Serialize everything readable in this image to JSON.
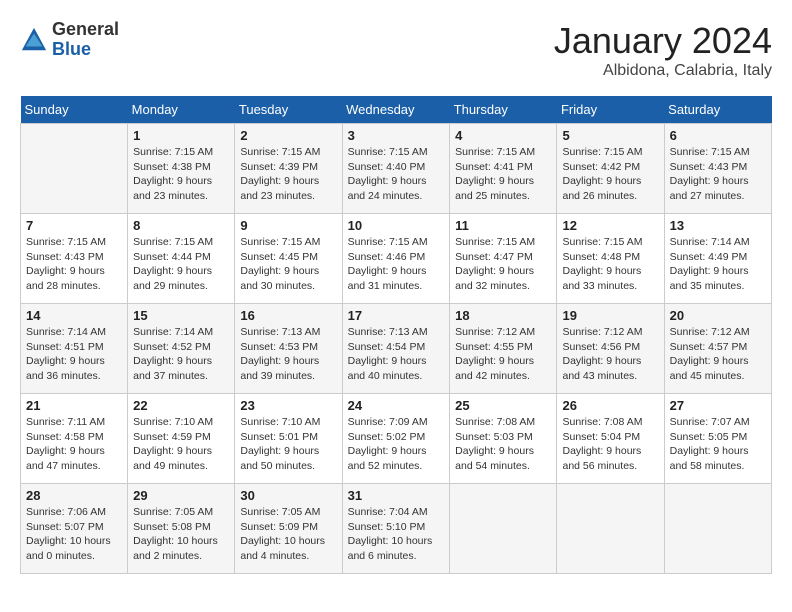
{
  "logo": {
    "general": "General",
    "blue": "Blue"
  },
  "header": {
    "month": "January 2024",
    "location": "Albidona, Calabria, Italy"
  },
  "weekdays": [
    "Sunday",
    "Monday",
    "Tuesday",
    "Wednesday",
    "Thursday",
    "Friday",
    "Saturday"
  ],
  "weeks": [
    [
      {
        "day": "",
        "info": ""
      },
      {
        "day": "1",
        "info": "Sunrise: 7:15 AM\nSunset: 4:38 PM\nDaylight: 9 hours\nand 23 minutes."
      },
      {
        "day": "2",
        "info": "Sunrise: 7:15 AM\nSunset: 4:39 PM\nDaylight: 9 hours\nand 23 minutes."
      },
      {
        "day": "3",
        "info": "Sunrise: 7:15 AM\nSunset: 4:40 PM\nDaylight: 9 hours\nand 24 minutes."
      },
      {
        "day": "4",
        "info": "Sunrise: 7:15 AM\nSunset: 4:41 PM\nDaylight: 9 hours\nand 25 minutes."
      },
      {
        "day": "5",
        "info": "Sunrise: 7:15 AM\nSunset: 4:42 PM\nDaylight: 9 hours\nand 26 minutes."
      },
      {
        "day": "6",
        "info": "Sunrise: 7:15 AM\nSunset: 4:43 PM\nDaylight: 9 hours\nand 27 minutes."
      }
    ],
    [
      {
        "day": "7",
        "info": "Sunrise: 7:15 AM\nSunset: 4:43 PM\nDaylight: 9 hours\nand 28 minutes."
      },
      {
        "day": "8",
        "info": "Sunrise: 7:15 AM\nSunset: 4:44 PM\nDaylight: 9 hours\nand 29 minutes."
      },
      {
        "day": "9",
        "info": "Sunrise: 7:15 AM\nSunset: 4:45 PM\nDaylight: 9 hours\nand 30 minutes."
      },
      {
        "day": "10",
        "info": "Sunrise: 7:15 AM\nSunset: 4:46 PM\nDaylight: 9 hours\nand 31 minutes."
      },
      {
        "day": "11",
        "info": "Sunrise: 7:15 AM\nSunset: 4:47 PM\nDaylight: 9 hours\nand 32 minutes."
      },
      {
        "day": "12",
        "info": "Sunrise: 7:15 AM\nSunset: 4:48 PM\nDaylight: 9 hours\nand 33 minutes."
      },
      {
        "day": "13",
        "info": "Sunrise: 7:14 AM\nSunset: 4:49 PM\nDaylight: 9 hours\nand 35 minutes."
      }
    ],
    [
      {
        "day": "14",
        "info": "Sunrise: 7:14 AM\nSunset: 4:51 PM\nDaylight: 9 hours\nand 36 minutes."
      },
      {
        "day": "15",
        "info": "Sunrise: 7:14 AM\nSunset: 4:52 PM\nDaylight: 9 hours\nand 37 minutes."
      },
      {
        "day": "16",
        "info": "Sunrise: 7:13 AM\nSunset: 4:53 PM\nDaylight: 9 hours\nand 39 minutes."
      },
      {
        "day": "17",
        "info": "Sunrise: 7:13 AM\nSunset: 4:54 PM\nDaylight: 9 hours\nand 40 minutes."
      },
      {
        "day": "18",
        "info": "Sunrise: 7:12 AM\nSunset: 4:55 PM\nDaylight: 9 hours\nand 42 minutes."
      },
      {
        "day": "19",
        "info": "Sunrise: 7:12 AM\nSunset: 4:56 PM\nDaylight: 9 hours\nand 43 minutes."
      },
      {
        "day": "20",
        "info": "Sunrise: 7:12 AM\nSunset: 4:57 PM\nDaylight: 9 hours\nand 45 minutes."
      }
    ],
    [
      {
        "day": "21",
        "info": "Sunrise: 7:11 AM\nSunset: 4:58 PM\nDaylight: 9 hours\nand 47 minutes."
      },
      {
        "day": "22",
        "info": "Sunrise: 7:10 AM\nSunset: 4:59 PM\nDaylight: 9 hours\nand 49 minutes."
      },
      {
        "day": "23",
        "info": "Sunrise: 7:10 AM\nSunset: 5:01 PM\nDaylight: 9 hours\nand 50 minutes."
      },
      {
        "day": "24",
        "info": "Sunrise: 7:09 AM\nSunset: 5:02 PM\nDaylight: 9 hours\nand 52 minutes."
      },
      {
        "day": "25",
        "info": "Sunrise: 7:08 AM\nSunset: 5:03 PM\nDaylight: 9 hours\nand 54 minutes."
      },
      {
        "day": "26",
        "info": "Sunrise: 7:08 AM\nSunset: 5:04 PM\nDaylight: 9 hours\nand 56 minutes."
      },
      {
        "day": "27",
        "info": "Sunrise: 7:07 AM\nSunset: 5:05 PM\nDaylight: 9 hours\nand 58 minutes."
      }
    ],
    [
      {
        "day": "28",
        "info": "Sunrise: 7:06 AM\nSunset: 5:07 PM\nDaylight: 10 hours\nand 0 minutes."
      },
      {
        "day": "29",
        "info": "Sunrise: 7:05 AM\nSunset: 5:08 PM\nDaylight: 10 hours\nand 2 minutes."
      },
      {
        "day": "30",
        "info": "Sunrise: 7:05 AM\nSunset: 5:09 PM\nDaylight: 10 hours\nand 4 minutes."
      },
      {
        "day": "31",
        "info": "Sunrise: 7:04 AM\nSunset: 5:10 PM\nDaylight: 10 hours\nand 6 minutes."
      },
      {
        "day": "",
        "info": ""
      },
      {
        "day": "",
        "info": ""
      },
      {
        "day": "",
        "info": ""
      }
    ]
  ]
}
